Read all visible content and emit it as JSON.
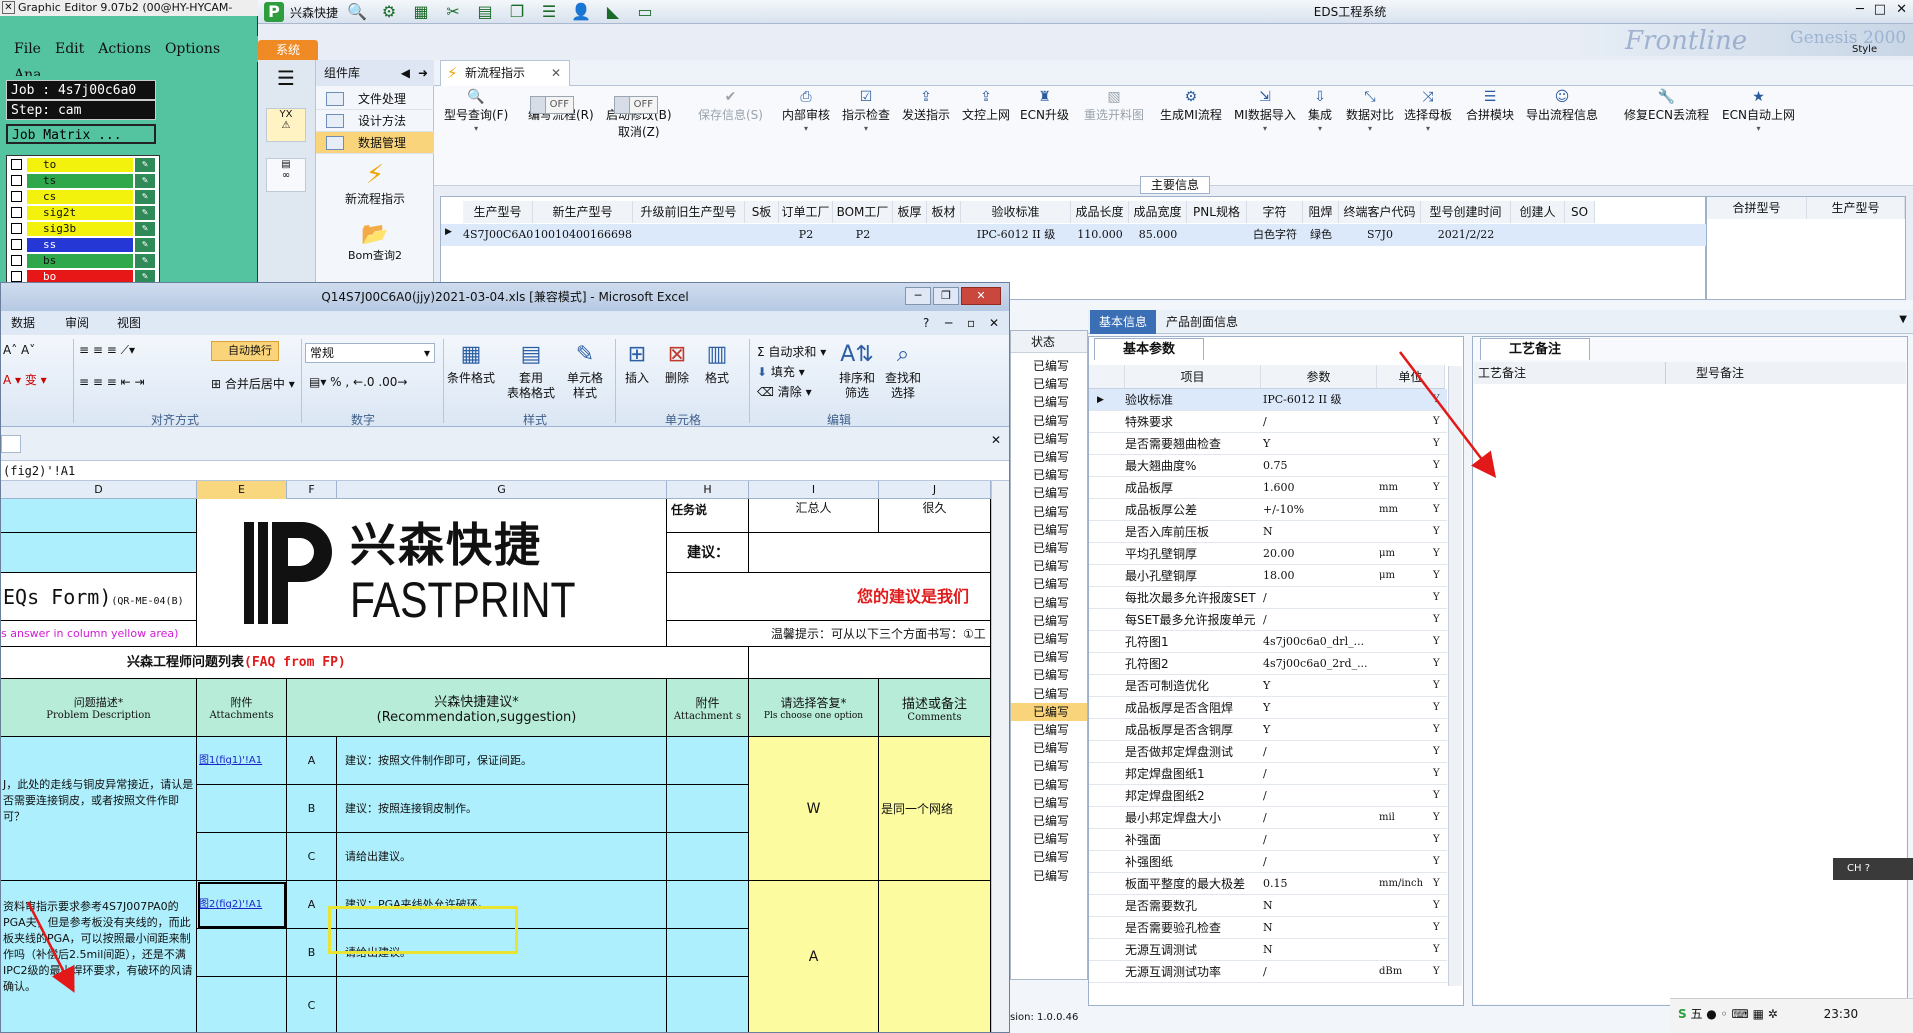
{
  "graphic_editor": {
    "title": "Graphic Editor 9.07b2 (00@HY-HYCAM-",
    "menu": [
      "File",
      "Edit",
      "Actions",
      "Options",
      "Ana"
    ],
    "job": "Job : 4s7j00c6a0",
    "step": "Step: cam",
    "job_matrix": "Job Matrix ...",
    "layers": [
      {
        "name": "to",
        "color": "#f2f20c"
      },
      {
        "name": "ts",
        "color": "#2ea84a"
      },
      {
        "name": "cs",
        "color": "#f2f20c"
      },
      {
        "name": "sig2t",
        "color": "#f2f20c"
      },
      {
        "name": "sig3b",
        "color": "#f2f20c"
      },
      {
        "name": "ss",
        "color": "#2538d6"
      },
      {
        "name": "bs",
        "color": "#2ea84a"
      },
      {
        "name": "bo",
        "color": "#e81717"
      }
    ]
  },
  "eds": {
    "app_name": "兴森快捷",
    "window_title": "EDS工程系统",
    "brand_text": "Frontline",
    "brand_text2": "Genesis 2000",
    "style_label": "Style",
    "system_tab": "系统",
    "component_lib": "组件库",
    "lib_items": [
      "文件处理",
      "设计方法",
      "数据管理"
    ],
    "lib_tools": [
      "新流程指示",
      "Bom查询2"
    ],
    "open_tab": "新流程指示",
    "ribbon": [
      {
        "label": "型号查询(F)",
        "icon": "search-icon",
        "disabled": false
      },
      {
        "label": "编写流程(R)",
        "icon": "toggle",
        "disabled": false
      },
      {
        "label": "启动修改(B)",
        "sub": "取消(Z)",
        "icon": "toggle",
        "disabled": false
      },
      {
        "label": "保存信息(S)",
        "icon": "check-icon",
        "disabled": true
      },
      {
        "label": "内部审核",
        "icon": "printer-icon",
        "disabled": false
      },
      {
        "label": "指示检查",
        "icon": "checklist-icon",
        "disabled": false
      },
      {
        "label": "发送指示",
        "icon": "upload-icon",
        "disabled": false
      },
      {
        "label": "文控上网",
        "icon": "upload-icon",
        "disabled": false
      },
      {
        "label": "ECN升级",
        "icon": "ecn-icon",
        "disabled": false
      },
      {
        "label": "重选开料图",
        "icon": "image-icon",
        "disabled": true
      },
      {
        "label": "生成MI流程",
        "icon": "gear-icon",
        "disabled": false
      },
      {
        "label": "MI数据导入",
        "icon": "import-icon",
        "disabled": false
      },
      {
        "label": "集成",
        "icon": "download-icon",
        "disabled": false
      },
      {
        "label": "数据对比",
        "icon": "compare-icon",
        "disabled": false
      },
      {
        "label": "选择母板",
        "icon": "shuffle-icon",
        "disabled": false
      },
      {
        "label": "合拼模块",
        "icon": "list-icon",
        "disabled": false
      },
      {
        "label": "导出流程信息",
        "icon": "smile-icon",
        "disabled": false
      },
      {
        "label": "修复ECN丢流程",
        "icon": "wrench-icon",
        "disabled": false
      },
      {
        "label": "ECN自动上网",
        "icon": "star-icon",
        "disabled": false
      }
    ],
    "toggle_off": "OFF",
    "main_info_label": "主要信息",
    "main_grid": {
      "headers": [
        "生产型号",
        "新生产型号",
        "升级前旧生产型号",
        "S板",
        "订单工厂",
        "BOM工厂",
        "板厚",
        "板材",
        "验收标准",
        "成品长度",
        "成品宽度",
        "PNL规格",
        "字符",
        "阻焊",
        "终端客户代码",
        "型号创建时间",
        "创建人",
        "SO"
      ],
      "row": [
        "4S7J00C6A0",
        "10010400166698",
        "",
        "",
        "P2",
        "P2",
        "",
        "",
        "IPC-6012 II 级",
        "110.000",
        "85.000",
        "",
        "白色字符",
        "绿色",
        "S7J0",
        "2021/2/22",
        "",
        ""
      ]
    },
    "side_grid_headers": [
      "合拼型号",
      "生产型号"
    ],
    "status_header": "状态",
    "status_value": "已编写",
    "status_count": 29,
    "lower_tabs": [
      "基本信息",
      "产品剖面信息"
    ],
    "basic_params_tab": "基本参数",
    "basic_params_headers": [
      "项目",
      "参数",
      "单位"
    ],
    "basic_params": [
      {
        "item": "验收标准",
        "value": "IPC-6012 II 级",
        "unit": "",
        "flag": "Y"
      },
      {
        "item": "特殊要求",
        "value": "/",
        "unit": "",
        "flag": "Y"
      },
      {
        "item": "是否需要翘曲检查",
        "value": "Y",
        "unit": "",
        "flag": "Y"
      },
      {
        "item": "最大翘曲度%",
        "value": "0.75",
        "unit": "",
        "flag": "Y"
      },
      {
        "item": "成品板厚",
        "value": "1.600",
        "unit": "mm",
        "flag": "Y"
      },
      {
        "item": "成品板厚公差",
        "value": "+/-10%",
        "unit": "mm",
        "flag": "Y"
      },
      {
        "item": "是否入库前压板",
        "value": "N",
        "unit": "",
        "flag": "Y"
      },
      {
        "item": "平均孔壁铜厚",
        "value": "20.00",
        "unit": "μm",
        "flag": "Y"
      },
      {
        "item": "最小孔壁铜厚",
        "value": "18.00",
        "unit": "μm",
        "flag": "Y"
      },
      {
        "item": "每批次最多允许报废SET",
        "value": "/",
        "unit": "",
        "flag": "Y"
      },
      {
        "item": "每SET最多允许报废单元",
        "value": "/",
        "unit": "",
        "flag": "Y"
      },
      {
        "item": "孔符图1",
        "value": "4s7j00c6a0_drl_...",
        "unit": "",
        "flag": "Y"
      },
      {
        "item": "孔符图2",
        "value": "4s7j00c6a0_2rd_...",
        "unit": "",
        "flag": "Y"
      },
      {
        "item": "是否可制造优化",
        "value": "Y",
        "unit": "",
        "flag": "Y"
      },
      {
        "item": "成品板厚是否含阻焊",
        "value": "Y",
        "unit": "",
        "flag": "Y"
      },
      {
        "item": "成品板厚是否含铜厚",
        "value": "Y",
        "unit": "",
        "flag": "Y"
      },
      {
        "item": "是否做邦定焊盘测试",
        "value": "/",
        "unit": "",
        "flag": "Y"
      },
      {
        "item": "邦定焊盘图纸1",
        "value": "/",
        "unit": "",
        "flag": "Y"
      },
      {
        "item": "邦定焊盘图纸2",
        "value": "/",
        "unit": "",
        "flag": "Y"
      },
      {
        "item": "最小邦定焊盘大小",
        "value": "/",
        "unit": "mil",
        "flag": "Y"
      },
      {
        "item": "补强面",
        "value": "/",
        "unit": "",
        "flag": "Y"
      },
      {
        "item": "补强图纸",
        "value": "/",
        "unit": "",
        "flag": "Y"
      },
      {
        "item": "板面平整度的最大极差",
        "value": "0.15",
        "unit": "mm/inch",
        "flag": "Y"
      },
      {
        "item": "是否需要数孔",
        "value": "N",
        "unit": "",
        "flag": "Y"
      },
      {
        "item": "是否需要验孔检查",
        "value": "N",
        "unit": "",
        "flag": "Y"
      },
      {
        "item": "无源互调测试",
        "value": "N",
        "unit": "",
        "flag": "Y"
      },
      {
        "item": "无源互调测试功率",
        "value": "/",
        "unit": "dBm",
        "flag": "Y"
      }
    ],
    "process_tab": "工艺备注",
    "process_headers": [
      "工艺备注",
      "型号备注"
    ],
    "ime_label": "CH",
    "version": "sion: 1.0.0.46",
    "clock": "23:30"
  },
  "excel": {
    "title": "Q14S7J00C6A0(jjy)2021-03-04.xls  [兼容模式] - Microsoft Excel",
    "tabs": [
      "数据",
      "审阅",
      "视图"
    ],
    "wrap_text": "自动换行",
    "merge_center": "合并后居中",
    "number_format": "常规",
    "group_labels": [
      "对齐方式",
      "数字",
      "样式",
      "单元格",
      "编辑"
    ],
    "style_buttons": [
      "条件格式",
      "套用\n表格格式",
      "单元格\n样式"
    ],
    "cell_buttons": [
      "插入",
      "删除",
      "格式"
    ],
    "edit_items": [
      "自动求和",
      "填充",
      "清除"
    ],
    "sort_filter": "排序和\n筛选",
    "find_select": "查找和\n选择",
    "formula": "(fig2)'!A1",
    "columns": [
      "D",
      "E",
      "F",
      "G",
      "H",
      "I",
      "J"
    ],
    "logo_cn": "兴森快捷",
    "logo_en": "FASTPRINT",
    "form_title": "EQs Form)",
    "form_code": "(QR-ME-04(B)",
    "answer_hint": "s answer in column yellow area)",
    "suggest_label": "建议：",
    "suggest_red": "您的建议是我们",
    "reminder": "温馨提示：可从以下三个方面书写：①工",
    "top_h_partial": "任务说",
    "top_i_partial": "汇总人",
    "top_j_partial": "很久",
    "faq_title": "兴森工程师问题列表",
    "faq_suffix": "(FAQ from FP)",
    "hdr_problem": "问题描述*",
    "hdr_problem_en": "Problem Description",
    "hdr_attach": "附件",
    "hdr_attach_en": "Attachments",
    "hdr_suggest": "兴森快捷建议*",
    "hdr_suggest_en": "(Recommendation,suggestion)",
    "hdr_attach2": "附件",
    "hdr_attach2_en": "Attachment s",
    "hdr_choose": "请选择答复*",
    "hdr_choose_en": "Pls choose one option",
    "hdr_comment": "描述或备注",
    "hdr_comment_en": "Comments",
    "q1_text": "J，此处的走线与铜皮异常接近，请认是否需要连接铜皮，或者按照文件作即可？",
    "q1_link": "图1(fig1)'!A1",
    "q1_options": [
      {
        "opt": "A",
        "text": "建议：按照文件制作即可，保证间距。"
      },
      {
        "opt": "B",
        "text": "建议：按照连接铜皮制作。"
      },
      {
        "opt": "C",
        "text": "请给出建议。"
      }
    ],
    "q1_answer": "W",
    "q1_comment": "是同一个网络",
    "q2_text": "资料审指示要求参考4S7J007PA0的PGA夫，但是参考板没有夹线的，而此板夹线的PGA，可以按照最小间距来制作吗（补偿后2.5mil间距），还是不满IPC2级的最小焊环要求，有破环的风请确认。",
    "q2_link": "图2(fig2)'!A1",
    "q2_options": [
      {
        "opt": "A",
        "text": "建议：PGA夹线处允许破环。"
      },
      {
        "opt": "B",
        "text": "请给出建议。"
      },
      {
        "opt": "C",
        "text": ""
      }
    ],
    "q2_answer": "A"
  }
}
